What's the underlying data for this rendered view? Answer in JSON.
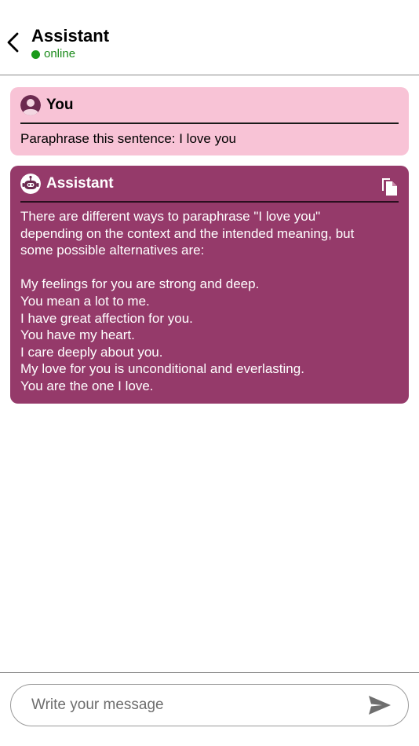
{
  "header": {
    "title": "Assistant",
    "status": "online",
    "status_color": "#1a9a1a"
  },
  "messages": [
    {
      "sender": "You",
      "avatar": "user-avatar-icon",
      "background": "#f8c3d6",
      "text": "Paraphrase this sentence: I love you"
    },
    {
      "sender": "Assistant",
      "avatar": "robot-avatar-icon",
      "background": "#953a6a",
      "copy_icon": "copy-icon",
      "intro": [
        "There are different ways to paraphrase \"I love you\"",
        "depending on the context and the intended meaning, but",
        "some possible alternatives are:"
      ],
      "alternatives": [
        "My feelings for you are strong and deep.",
        "You mean a lot to me.",
        "I have great affection for you.",
        "You have my heart.",
        "I care deeply about you.",
        "My love for you is unconditional and everlasting.",
        "You are the one I love."
      ]
    }
  ],
  "composer": {
    "placeholder": "Write your message",
    "value": "",
    "send_icon": "send-icon"
  }
}
